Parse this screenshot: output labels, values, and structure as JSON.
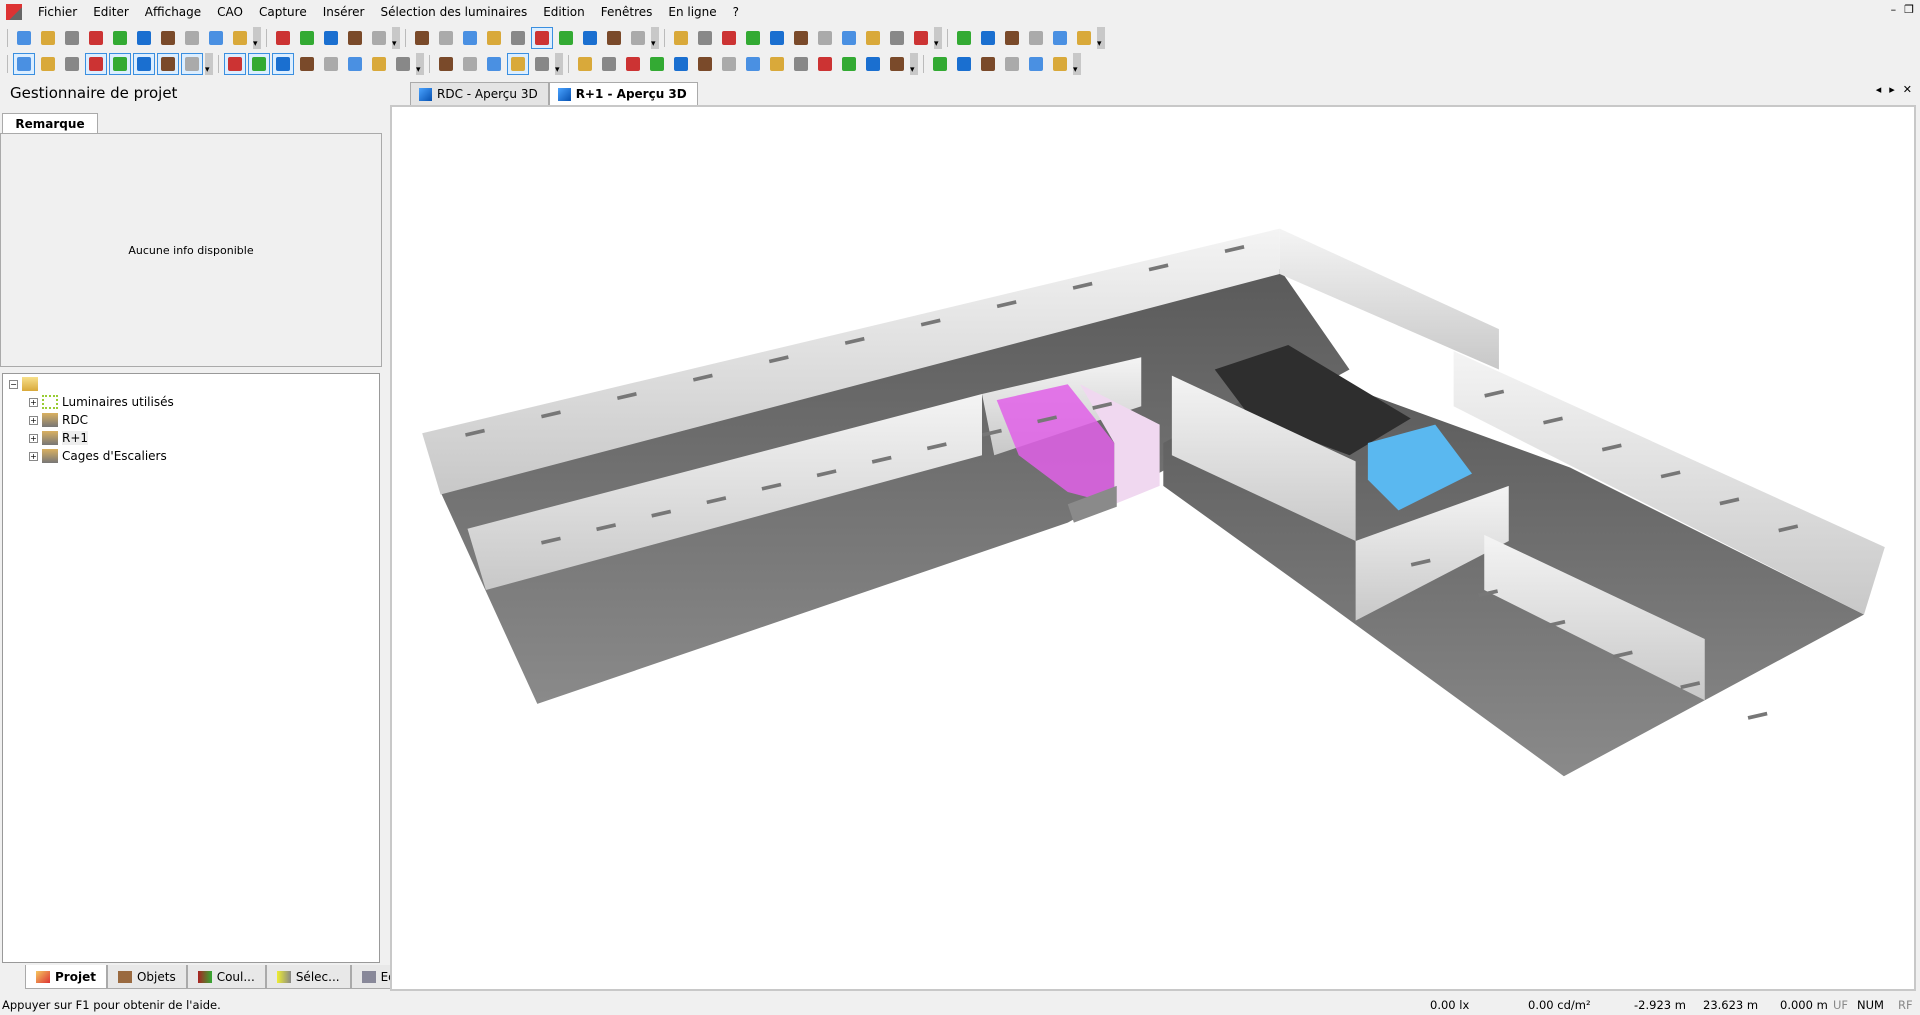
{
  "menu": [
    "Fichier",
    "Editer",
    "Affichage",
    "CAO",
    "Capture",
    "Insérer",
    "Sélection des luminaires",
    "Edition",
    "Fenêtres",
    "En ligne",
    "?"
  ],
  "left_panel": {
    "title": "Gestionnaire de projet",
    "remark_tab": "Remarque",
    "remark_text": "Aucune info disponible",
    "tree": [
      "Luminaires utilisés",
      "RDC",
      "R+1",
      "Cages d'Escaliers"
    ],
    "bottom_tabs": [
      "Projet",
      "Objets",
      "Coul...",
      "Sélec...",
      "Edition"
    ]
  },
  "view_tabs": [
    "RDC - Aperçu 3D",
    "R+1 - Aperçu 3D"
  ],
  "status": {
    "help": "Appuyer sur F1 pour obtenir de l'aide.",
    "illuminance": "0.00 lx",
    "luminance": "0.00 cd/m²",
    "x": "-2.923 m",
    "y": "23.623 m",
    "z": "0.000 m",
    "uf": "UF",
    "num": "NUM",
    "rf": "RF"
  },
  "colors": {
    "accent": "#3a8fe0",
    "room_magenta": "#e060e8",
    "room_blue": "#5ab8f0"
  }
}
